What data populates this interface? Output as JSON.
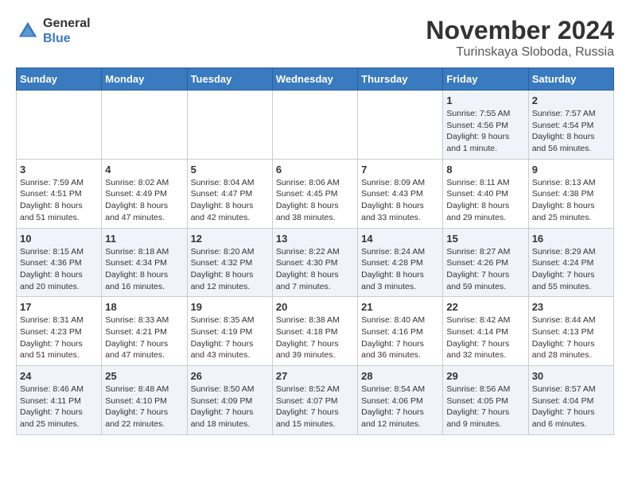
{
  "logo": {
    "general": "General",
    "blue": "Blue"
  },
  "title": "November 2024",
  "subtitle": "Turinskaya Sloboda, Russia",
  "headers": [
    "Sunday",
    "Monday",
    "Tuesday",
    "Wednesday",
    "Thursday",
    "Friday",
    "Saturday"
  ],
  "weeks": [
    [
      {
        "day": "",
        "info": ""
      },
      {
        "day": "",
        "info": ""
      },
      {
        "day": "",
        "info": ""
      },
      {
        "day": "",
        "info": ""
      },
      {
        "day": "",
        "info": ""
      },
      {
        "day": "1",
        "info": "Sunrise: 7:55 AM\nSunset: 4:56 PM\nDaylight: 9 hours\nand 1 minute."
      },
      {
        "day": "2",
        "info": "Sunrise: 7:57 AM\nSunset: 4:54 PM\nDaylight: 8 hours\nand 56 minutes."
      }
    ],
    [
      {
        "day": "3",
        "info": "Sunrise: 7:59 AM\nSunset: 4:51 PM\nDaylight: 8 hours\nand 51 minutes."
      },
      {
        "day": "4",
        "info": "Sunrise: 8:02 AM\nSunset: 4:49 PM\nDaylight: 8 hours\nand 47 minutes."
      },
      {
        "day": "5",
        "info": "Sunrise: 8:04 AM\nSunset: 4:47 PM\nDaylight: 8 hours\nand 42 minutes."
      },
      {
        "day": "6",
        "info": "Sunrise: 8:06 AM\nSunset: 4:45 PM\nDaylight: 8 hours\nand 38 minutes."
      },
      {
        "day": "7",
        "info": "Sunrise: 8:09 AM\nSunset: 4:43 PM\nDaylight: 8 hours\nand 33 minutes."
      },
      {
        "day": "8",
        "info": "Sunrise: 8:11 AM\nSunset: 4:40 PM\nDaylight: 8 hours\nand 29 minutes."
      },
      {
        "day": "9",
        "info": "Sunrise: 8:13 AM\nSunset: 4:38 PM\nDaylight: 8 hours\nand 25 minutes."
      }
    ],
    [
      {
        "day": "10",
        "info": "Sunrise: 8:15 AM\nSunset: 4:36 PM\nDaylight: 8 hours\nand 20 minutes."
      },
      {
        "day": "11",
        "info": "Sunrise: 8:18 AM\nSunset: 4:34 PM\nDaylight: 8 hours\nand 16 minutes."
      },
      {
        "day": "12",
        "info": "Sunrise: 8:20 AM\nSunset: 4:32 PM\nDaylight: 8 hours\nand 12 minutes."
      },
      {
        "day": "13",
        "info": "Sunrise: 8:22 AM\nSunset: 4:30 PM\nDaylight: 8 hours\nand 7 minutes."
      },
      {
        "day": "14",
        "info": "Sunrise: 8:24 AM\nSunset: 4:28 PM\nDaylight: 8 hours\nand 3 minutes."
      },
      {
        "day": "15",
        "info": "Sunrise: 8:27 AM\nSunset: 4:26 PM\nDaylight: 7 hours\nand 59 minutes."
      },
      {
        "day": "16",
        "info": "Sunrise: 8:29 AM\nSunset: 4:24 PM\nDaylight: 7 hours\nand 55 minutes."
      }
    ],
    [
      {
        "day": "17",
        "info": "Sunrise: 8:31 AM\nSunset: 4:23 PM\nDaylight: 7 hours\nand 51 minutes."
      },
      {
        "day": "18",
        "info": "Sunrise: 8:33 AM\nSunset: 4:21 PM\nDaylight: 7 hours\nand 47 minutes."
      },
      {
        "day": "19",
        "info": "Sunrise: 8:35 AM\nSunset: 4:19 PM\nDaylight: 7 hours\nand 43 minutes."
      },
      {
        "day": "20",
        "info": "Sunrise: 8:38 AM\nSunset: 4:18 PM\nDaylight: 7 hours\nand 39 minutes."
      },
      {
        "day": "21",
        "info": "Sunrise: 8:40 AM\nSunset: 4:16 PM\nDaylight: 7 hours\nand 36 minutes."
      },
      {
        "day": "22",
        "info": "Sunrise: 8:42 AM\nSunset: 4:14 PM\nDaylight: 7 hours\nand 32 minutes."
      },
      {
        "day": "23",
        "info": "Sunrise: 8:44 AM\nSunset: 4:13 PM\nDaylight: 7 hours\nand 28 minutes."
      }
    ],
    [
      {
        "day": "24",
        "info": "Sunrise: 8:46 AM\nSunset: 4:11 PM\nDaylight: 7 hours\nand 25 minutes."
      },
      {
        "day": "25",
        "info": "Sunrise: 8:48 AM\nSunset: 4:10 PM\nDaylight: 7 hours\nand 22 minutes."
      },
      {
        "day": "26",
        "info": "Sunrise: 8:50 AM\nSunset: 4:09 PM\nDaylight: 7 hours\nand 18 minutes."
      },
      {
        "day": "27",
        "info": "Sunrise: 8:52 AM\nSunset: 4:07 PM\nDaylight: 7 hours\nand 15 minutes."
      },
      {
        "day": "28",
        "info": "Sunrise: 8:54 AM\nSunset: 4:06 PM\nDaylight: 7 hours\nand 12 minutes."
      },
      {
        "day": "29",
        "info": "Sunrise: 8:56 AM\nSunset: 4:05 PM\nDaylight: 7 hours\nand 9 minutes."
      },
      {
        "day": "30",
        "info": "Sunrise: 8:57 AM\nSunset: 4:04 PM\nDaylight: 7 hours\nand 6 minutes."
      }
    ]
  ]
}
